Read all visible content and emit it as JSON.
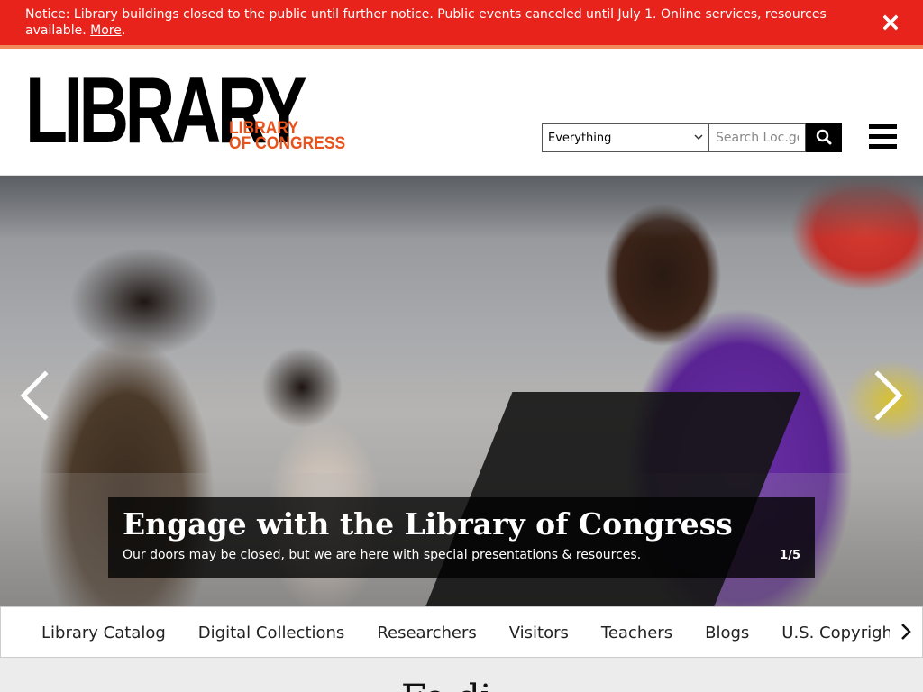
{
  "alert": {
    "text": "Notice: Library buildings closed to the public until further notice. Public events canceled until July 1. Online services, resources available.",
    "more_label": "More",
    "period": ".",
    "close_icon": "close-icon"
  },
  "header": {
    "logo_big": "LIBRARY",
    "logo_line1": "LIBRARY",
    "logo_line2": "OF CONGRESS",
    "search": {
      "scope_selected": "Everything",
      "placeholder": "Search Loc.gov",
      "button_icon": "search-icon"
    },
    "menu_icon": "hamburger-menu-icon"
  },
  "hero": {
    "title": "Engage with the Library of Congress",
    "subtitle": "Our doors may be closed, but we are here with special presentations & resources.",
    "counter": "1/5",
    "prev_icon": "chevron-left-icon",
    "next_icon": "chevron-right-icon"
  },
  "tabs": [
    "Library Catalog",
    "Digital Collections",
    "Researchers",
    "Visitors",
    "Teachers",
    "Blogs",
    "U.S. Copyright Off"
  ],
  "below": {
    "heading_partial": "Fe    di"
  },
  "colors": {
    "alert_red": "#e8231b",
    "brand_orange": "#e8521b"
  }
}
